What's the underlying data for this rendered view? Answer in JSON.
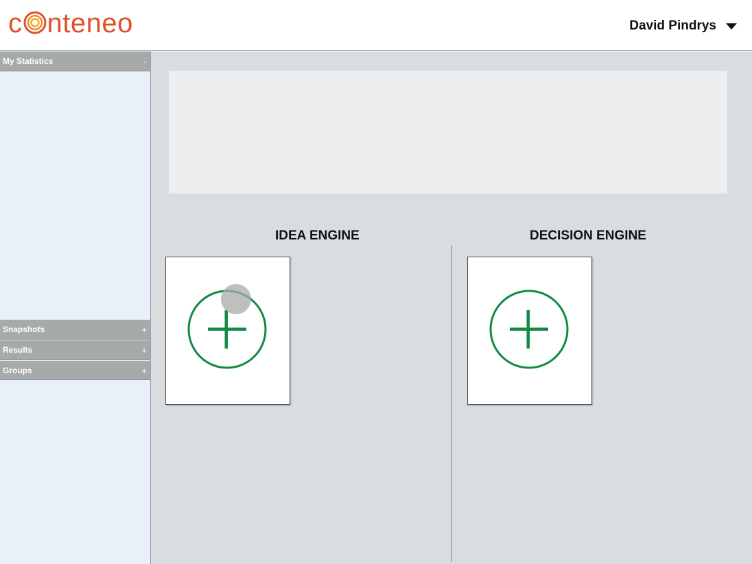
{
  "header": {
    "logo_text_pre": "c",
    "logo_text_post": "nteneo",
    "logo_icon": "concentric-circles-o",
    "user_name": "David Pindrys",
    "user_menu_icon": "caret-down-icon"
  },
  "sidebar": {
    "panels": [
      {
        "label": "My Statistics",
        "toggle": "-"
      },
      {
        "label": "Snapshots",
        "toggle": "+"
      },
      {
        "label": "Results",
        "toggle": "+"
      },
      {
        "label": "Groups",
        "toggle": "+"
      }
    ]
  },
  "main": {
    "idea_engine": {
      "title": "IDEA ENGINE",
      "add_icon": "plus-circle-icon"
    },
    "decision_engine": {
      "title": "DECISION ENGINE",
      "add_icon": "plus-circle-icon"
    }
  },
  "colors": {
    "brand": "#e0502a",
    "brand_accent": "#f5a623",
    "add_green": "#118a45",
    "panel_header": "#a6aaa8",
    "sidebar_bg": "#e8f0f9",
    "main_bg": "#d9dde0"
  }
}
